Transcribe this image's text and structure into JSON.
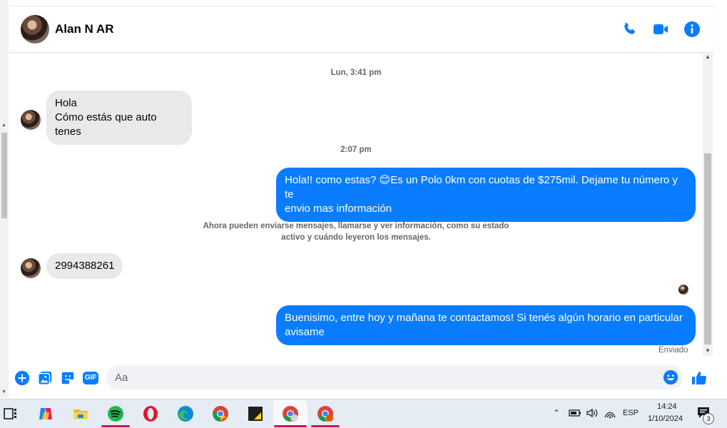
{
  "conversation": {
    "contact_name": "Alan N AR",
    "header_icons": [
      "phone-icon",
      "video-call-icon",
      "info-icon"
    ]
  },
  "messages": {
    "ts1": "Lun, 3:41 pm",
    "in1_line1": "Hola",
    "in1_line2": "Cómo estás que auto tenes",
    "ts2": "2:07 pm",
    "out1_line1": "Hola!! como estas? 😊Es un Polo 0km con cuotas de $275mil. Dejame tu número y te",
    "out1_line2": "envio mas información",
    "notice_line1": "Ahora pueden enviarse mensajes, llamarse y ver información, como su estado",
    "notice_line2": "activo y cuándo leyeron los mensajes.",
    "in2": "2994388261",
    "out2_line1": "Buenisimo, entre hoy y mañana te contactamos! Si tenés algún horario en particular",
    "out2_line2": "avisame",
    "status": "Enviado"
  },
  "composer": {
    "placeholder": "Aa",
    "icons": [
      "plus-icon",
      "image-icon",
      "sticker-icon",
      "gif-icon",
      "emoji-icon",
      "like-icon"
    ],
    "gif_label": "GIF"
  },
  "taskbar": {
    "apps": [
      "task-view-icon",
      "copilot-icon",
      "file-explorer-icon",
      "spotify-icon",
      "opera-icon",
      "edge-icon",
      "chrome-icon",
      "sticky-notes-icon",
      "chrome-profile-icon",
      "chrome-profile-2-icon"
    ],
    "language": "ESP",
    "time": "14:24",
    "date": "1/10/2024",
    "notification_count": "3"
  },
  "colors": {
    "accent": "#0a7cff",
    "incoming_bubble": "#e9e9eb",
    "taskbar": "#e6ecf3"
  }
}
